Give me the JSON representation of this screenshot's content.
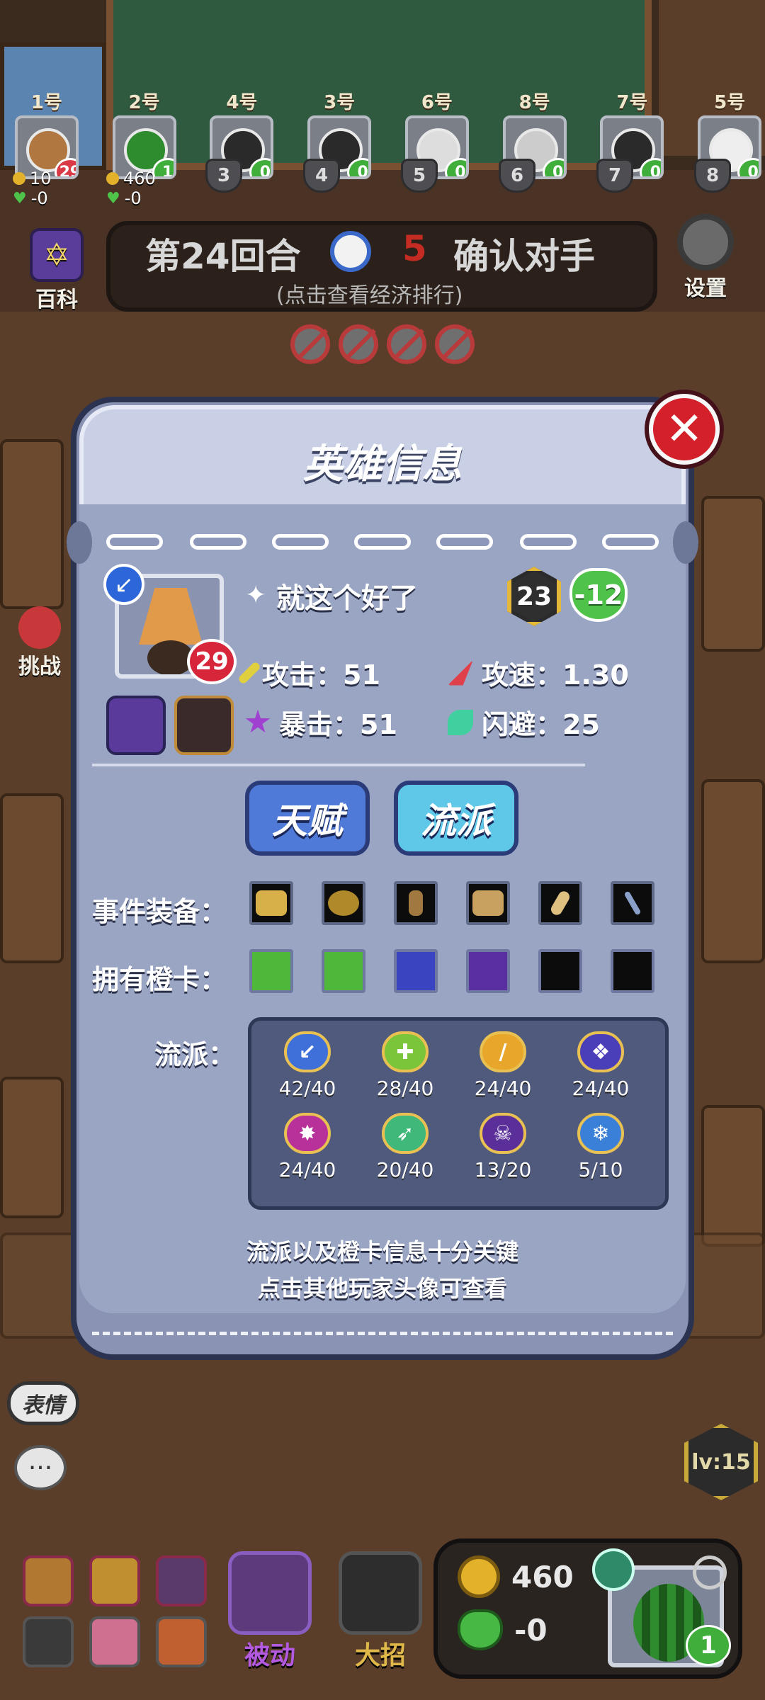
{
  "players": [
    {
      "num": "1号",
      "hp": "29",
      "hp_color": "red"
    },
    {
      "num": "2号",
      "hp": "1",
      "hp_color": "green"
    },
    {
      "num": "4号",
      "hp": "0",
      "hp_color": "green"
    },
    {
      "num": "3号",
      "hp": "0",
      "hp_color": "green"
    },
    {
      "num": "6号",
      "hp": "0",
      "hp_color": "green"
    },
    {
      "num": "8号",
      "hp": "0",
      "hp_color": "green"
    },
    {
      "num": "7号",
      "hp": "0",
      "hp_color": "green"
    },
    {
      "num": "5号",
      "hp": "0",
      "hp_color": "green"
    }
  ],
  "ranks": [
    "3",
    "4",
    "5",
    "6",
    "7",
    "8"
  ],
  "player_stats": [
    {
      "gold": "10",
      "delta": "-0"
    },
    {
      "gold": "460",
      "delta": "-0"
    }
  ],
  "side": {
    "wiki_label": "百科",
    "settings_label": "设置",
    "challenge_label": "挑战"
  },
  "round": {
    "title": "第24回合",
    "count": "5",
    "action": "确认对手",
    "subtitle": "(点击查看经济排行)"
  },
  "modal": {
    "title": "英雄信息",
    "close_symbol": "✕",
    "hero_hp": "29",
    "hero_name": "就这个好了",
    "level": "23",
    "hp_change": "-12",
    "stats": {
      "attack": "攻击：51",
      "attack_speed": "攻速：1.30",
      "crit": "暴击：51",
      "dodge": "闪避：25"
    },
    "tabs": {
      "talent": "天赋",
      "faction": "流派"
    },
    "event_label": "事件装备：",
    "orange_label": "拥有橙卡：",
    "faction_label": "流派：",
    "factions": [
      {
        "value": "42/40",
        "color": "#3f6fd8",
        "glyph": "↙"
      },
      {
        "value": "28/40",
        "color": "#7bc53a",
        "glyph": "✚"
      },
      {
        "value": "24/40",
        "color": "#e8a62a",
        "glyph": "/"
      },
      {
        "value": "24/40",
        "color": "#4a3fb8",
        "glyph": "❖"
      },
      {
        "value": "24/40",
        "color": "#b8309a",
        "glyph": "✸"
      },
      {
        "value": "20/40",
        "color": "#3fb87a",
        "glyph": "➶"
      },
      {
        "value": "13/20",
        "color": "#5a2f9a",
        "glyph": "☠"
      },
      {
        "value": "5/10",
        "color": "#3a7fd8",
        "glyph": "❄"
      }
    ],
    "tip_line1": "流派以及橙卡信息十分关键",
    "tip_line2": "点击其他玩家头像可查看"
  },
  "bottom": {
    "gold": "460",
    "delta": "-0",
    "my_hp": "1",
    "passive_label": "被动",
    "ultimate_label": "大招",
    "emote_label": "表情",
    "chat_symbol": "···",
    "level_label": "lv:15"
  },
  "colors": {
    "accent_blue": "#4f7ad8",
    "danger_red": "#d3202a",
    "hp_green": "#4fc24a"
  }
}
